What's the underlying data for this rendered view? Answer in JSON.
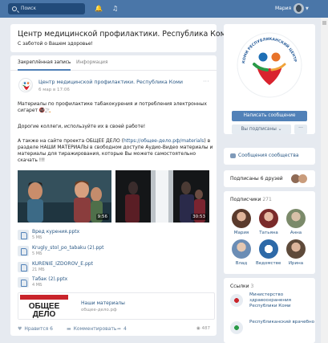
{
  "topbar": {
    "search_placeholder": "Поиск",
    "user_name": "Мария"
  },
  "group": {
    "title": "Центр медицинской профилактики. Республика Коми",
    "status": "С заботой о Вашем здоровье!"
  },
  "tabs": [
    {
      "label": "Закреплённая запись",
      "active": true
    },
    {
      "label": "Информация",
      "active": false
    }
  ],
  "post": {
    "author": "Центр медицинской профилактики. Республика Коми",
    "date": "6 мар в 17:06",
    "menu": "···",
    "paragraph1": "Материалы по профилактике табакокурения и потребления электронных сигарет 🚭🚬",
    "paragraph2": "Дорогие коллеги, используйте их в своей работе!",
    "paragraph3_a": "А также на сайте проекта ОБЩЕЕ ДЕЛО (",
    "paragraph3_link": "https://общее-дело.рф/materials",
    "paragraph3_b": ") в разделе НАШИ МАТЕРИАЛЫ в свободном доступе Аудио-Видео материалы и материалы для тиражирования, которые Вы можете самостоятельно скачать !!!",
    "videos": [
      {
        "duration": "9:56"
      },
      {
        "duration": "30:53"
      }
    ],
    "files": [
      {
        "name": "Вред курения.pptx",
        "size": "5 МБ"
      },
      {
        "name": "Krugly_stol_po_tabaku (2).ppt",
        "size": "5 МБ"
      },
      {
        "name": "KURENIE_IZDOROV_E.ppt",
        "size": "21 МБ"
      },
      {
        "name": "Табак (2).pptx",
        "size": "4 МБ"
      }
    ],
    "link": {
      "thumb_text": "ОБЩЕЕ ДЕЛО",
      "title": "Наши материалы",
      "domain": "общее-дело.рф"
    },
    "actions": {
      "like_label": "Нравится",
      "like_count": "6",
      "comment_label": "Комментировать",
      "share_count": "4",
      "views": "487"
    }
  },
  "sidebar": {
    "message_button": "Написать сообщение",
    "subscribed_button": "Вы подписаны ⌄",
    "more_button": "···",
    "community_messages": "Сообщения сообщества",
    "friends_subscribed": "Подписаны 6 друзей",
    "subscribers_title": "Подписчики",
    "subscribers_count": "271",
    "members": [
      {
        "name": "Мария"
      },
      {
        "name": "Татьяна"
      },
      {
        "name": "Анна"
      },
      {
        "name": "Влад"
      },
      {
        "name": "Ведомстве..."
      },
      {
        "name": "Ирина"
      }
    ],
    "links_title": "Ссылки",
    "links_count": "3",
    "links": [
      {
        "text": "Министерство здравоохранения Республики Коми"
      },
      {
        "text": "Республиканский врачебно"
      }
    ],
    "logo_text": "КОМИ РЕСПУБЛИКАНСКИЙ ЦЕНТР МЕДИЦИНСКОЙ ПРОФИЛАКТИКИ"
  },
  "colors": {
    "topbar": "#4a76a8",
    "accent": "#5181b8",
    "link": "#2a5885",
    "page_bg": "#e6eaf0"
  }
}
